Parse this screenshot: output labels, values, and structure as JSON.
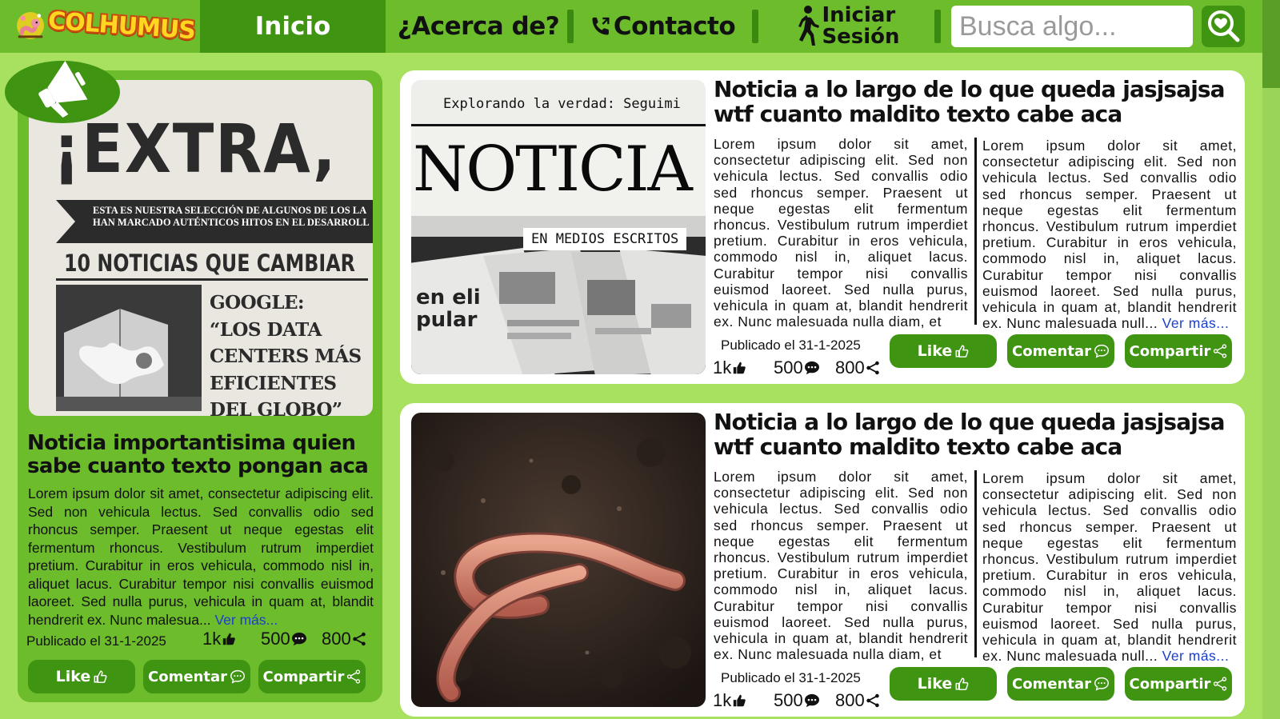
{
  "brand": {
    "logo_text": "COLHUMUS"
  },
  "nav": {
    "items": [
      {
        "label": "Inicio"
      },
      {
        "label": "¿Acerca de?"
      },
      {
        "label": "Contacto"
      },
      {
        "label": "Iniciar",
        "label2": "Sesión"
      }
    ]
  },
  "search": {
    "placeholder": "Busca algo..."
  },
  "colors": {
    "primary": "#6cbc2c",
    "dark": "#3f9412",
    "background": "#a8e060",
    "link": "#1a3fd0"
  },
  "featured": {
    "image": {
      "headline": "¡EXTRA,",
      "banner_line1": "ESTA ES NUESTRA SELECCIÓN DE ALGUNOS DE LOS LA",
      "banner_line2": "HAN MARCADO AUTÉNTICOS HITOS EN EL DESARROLL",
      "subhead": "10 NOTICIAS QUE CAMBIAR",
      "quote": [
        "GOOGLE:",
        "“LOS DATA",
        "CENTERS MÁS",
        "EFICIENTES",
        "DEL GLOBO”"
      ]
    },
    "title": "Noticia importantisima quien sabe cuanto texto pongan aca",
    "body": "Lorem ipsum dolor sit amet, consectetur adipiscing elit. Sed non vehicula lectus. Sed convallis odio sed rhoncus semper. Praesent ut neque egestas elit fermentum rhoncus. Vestibulum rutrum imperdiet pretium. Curabitur in eros vehicula, commodo nisl in, aliquet lacus. Curabitur tempor nisi convallis euismod laoreet. Sed nulla purus, vehicula in quam at, blandit hendrerit ex. Nunc malesua...",
    "more": "Ver más...",
    "date": "Publicado el 31-1-2025",
    "likes": "1k",
    "comments": "500",
    "shares": "800",
    "buttons": {
      "like": "Like",
      "comment": "Comentar",
      "share": "Compartir"
    }
  },
  "news": [
    {
      "image": {
        "top_text": "Explorando la verdad: Seguimi",
        "big_word": "NOTICIA",
        "tag": "EN MEDIOS ESCRITOS"
      },
      "title": "Noticia a lo largo de lo que queda jasjsajsa wtf cuanto maldito texto cabe aca",
      "col1": "Lorem ipsum dolor sit amet, consectetur adipiscing elit. Sed non vehicula lectus. Sed convallis odio sed rhoncus semper. Praesent ut neque egestas elit fermentum rhoncus. Vestibulum rutrum imperdiet pretium. Curabitur in eros vehicula, commodo nisl in, aliquet lacus. Curabitur tempor nisi convallis euismod laoreet. Sed nulla purus, vehicula in quam at, blandit hendrerit ex. Nunc malesuada nulla diam, et",
      "col2": "Lorem ipsum dolor sit amet, consectetur adipiscing elit. Sed non vehicula lectus. Sed convallis odio sed rhoncus semper. Praesent ut neque egestas elit fermentum rhoncus. Vestibulum rutrum imperdiet pretium. Curabitur in eros vehicula, commodo nisl in, aliquet lacus. Curabitur tempor nisi convallis euismod laoreet. Sed nulla purus, vehicula in quam at, blandit hendrerit ex. Nunc malesuada null...",
      "more": "Ver más...",
      "date": "Publicado el 31-1-2025",
      "likes": "1k",
      "comments": "500",
      "shares": "800",
      "buttons": {
        "like": "Like",
        "comment": "Comentar",
        "share": "Compartir"
      }
    },
    {
      "title": "Noticia a lo largo de lo que queda jasjsajsa wtf cuanto maldito texto cabe aca",
      "col1": "Lorem ipsum dolor sit amet, consectetur adipiscing elit. Sed non vehicula lectus. Sed convallis odio sed rhoncus semper. Praesent ut neque egestas elit fermentum rhoncus. Vestibulum rutrum imperdiet pretium. Curabitur in eros vehicula, commodo nisl in, aliquet lacus. Curabitur tempor nisi convallis euismod laoreet. Sed nulla purus, vehicula in quam at, blandit hendrerit ex. Nunc malesuada nulla diam, et",
      "col2": "Lorem ipsum dolor sit amet, consectetur adipiscing elit. Sed non vehicula lectus. Sed convallis odio sed rhoncus semper. Praesent ut neque egestas elit fermentum rhoncus. Vestibulum rutrum imperdiet pretium. Curabitur in eros vehicula, commodo nisl in, aliquet lacus. Curabitur tempor nisi convallis euismod laoreet. Sed nulla purus, vehicula in quam at, blandit hendrerit ex. Nunc malesuada null...",
      "more": "Ver más...",
      "date": "Publicado el 31-1-2025",
      "likes": "1k",
      "comments": "500",
      "shares": "800",
      "buttons": {
        "like": "Like",
        "comment": "Comentar",
        "share": "Compartir"
      }
    }
  ]
}
